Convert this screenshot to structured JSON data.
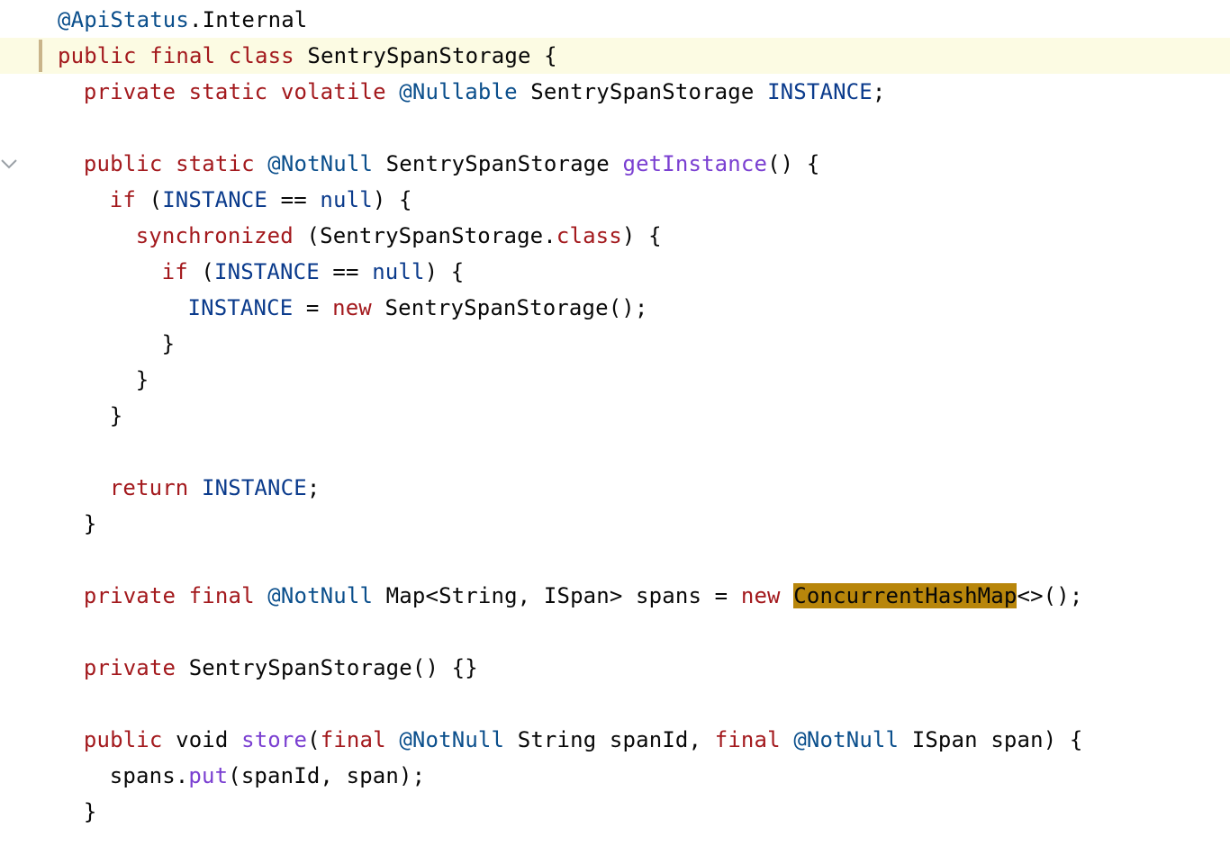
{
  "colors": {
    "plain": "#080808",
    "keyword": "#a3191d",
    "annotation": "#0b4f8c",
    "constant": "#0b3b8c",
    "method": "#7a3fd1",
    "fold_marker": "#9aa0a6"
  },
  "gutter": {
    "fold_markers": [
      {
        "line": 1,
        "icon": "chevron-down-icon"
      },
      {
        "line": 4,
        "icon": "chevron-down-icon"
      }
    ]
  },
  "code_lines": [
    {
      "indent": 4,
      "current": false,
      "segments": [
        {
          "text": "@ApiStatus",
          "kind": "annotation"
        },
        {
          "text": ".Internal",
          "kind": "plain"
        }
      ]
    },
    {
      "indent": 4,
      "current": true,
      "segments": [
        {
          "text": "public final class ",
          "kind": "keyword"
        },
        {
          "text": "SentrySpanStorage {",
          "kind": "plain"
        }
      ]
    },
    {
      "indent": 6,
      "current": false,
      "segments": [
        {
          "text": "private static volatile ",
          "kind": "keyword"
        },
        {
          "text": "@Nullable",
          "kind": "annotation"
        },
        {
          "text": " SentrySpanStorage ",
          "kind": "plain"
        },
        {
          "text": "INSTANCE",
          "kind": "constant"
        },
        {
          "text": ";",
          "kind": "plain"
        }
      ]
    },
    {
      "indent": 0,
      "current": false,
      "segments": []
    },
    {
      "indent": 6,
      "current": false,
      "segments": [
        {
          "text": "public static ",
          "kind": "keyword"
        },
        {
          "text": "@NotNull",
          "kind": "annotation"
        },
        {
          "text": " SentrySpanStorage ",
          "kind": "plain"
        },
        {
          "text": "getInstance",
          "kind": "method"
        },
        {
          "text": "() {",
          "kind": "plain"
        }
      ]
    },
    {
      "indent": 8,
      "current": false,
      "segments": [
        {
          "text": "if",
          "kind": "keyword"
        },
        {
          "text": " (",
          "kind": "plain"
        },
        {
          "text": "INSTANCE",
          "kind": "constant"
        },
        {
          "text": " == ",
          "kind": "plain"
        },
        {
          "text": "null",
          "kind": "constant"
        },
        {
          "text": ") {",
          "kind": "plain"
        }
      ]
    },
    {
      "indent": 10,
      "current": false,
      "segments": [
        {
          "text": "synchronized",
          "kind": "keyword"
        },
        {
          "text": " (SentrySpanStorage.",
          "kind": "plain"
        },
        {
          "text": "class",
          "kind": "keyword"
        },
        {
          "text": ") {",
          "kind": "plain"
        }
      ]
    },
    {
      "indent": 12,
      "current": false,
      "segments": [
        {
          "text": "if",
          "kind": "keyword"
        },
        {
          "text": " (",
          "kind": "plain"
        },
        {
          "text": "INSTANCE",
          "kind": "constant"
        },
        {
          "text": " == ",
          "kind": "plain"
        },
        {
          "text": "null",
          "kind": "constant"
        },
        {
          "text": ") {",
          "kind": "plain"
        }
      ]
    },
    {
      "indent": 14,
      "current": false,
      "segments": [
        {
          "text": "INSTANCE",
          "kind": "constant"
        },
        {
          "text": " = ",
          "kind": "plain"
        },
        {
          "text": "new",
          "kind": "keyword"
        },
        {
          "text": " SentrySpanStorage();",
          "kind": "plain"
        }
      ]
    },
    {
      "indent": 12,
      "current": false,
      "segments": [
        {
          "text": "}",
          "kind": "plain"
        }
      ]
    },
    {
      "indent": 10,
      "current": false,
      "segments": [
        {
          "text": "}",
          "kind": "plain"
        }
      ]
    },
    {
      "indent": 8,
      "current": false,
      "segments": [
        {
          "text": "}",
          "kind": "plain"
        }
      ]
    },
    {
      "indent": 0,
      "current": false,
      "segments": []
    },
    {
      "indent": 8,
      "current": false,
      "segments": [
        {
          "text": "return",
          "kind": "keyword"
        },
        {
          "text": " ",
          "kind": "plain"
        },
        {
          "text": "INSTANCE",
          "kind": "constant"
        },
        {
          "text": ";",
          "kind": "plain"
        }
      ]
    },
    {
      "indent": 6,
      "current": false,
      "segments": [
        {
          "text": "}",
          "kind": "plain"
        }
      ]
    },
    {
      "indent": 0,
      "current": false,
      "segments": []
    },
    {
      "indent": 6,
      "current": false,
      "segments": [
        {
          "text": "private final ",
          "kind": "keyword"
        },
        {
          "text": "@NotNull",
          "kind": "annotation"
        },
        {
          "text": " Map<String, ISpan> spans = ",
          "kind": "plain"
        },
        {
          "text": "new",
          "kind": "keyword"
        },
        {
          "text": " ",
          "kind": "plain"
        },
        {
          "text": "ConcurrentHashMap",
          "kind": "plain",
          "highlight": true
        },
        {
          "text": "<>();",
          "kind": "plain"
        }
      ]
    },
    {
      "indent": 0,
      "current": false,
      "segments": []
    },
    {
      "indent": 6,
      "current": false,
      "segments": [
        {
          "text": "private",
          "kind": "keyword"
        },
        {
          "text": " SentrySpanStorage() {}",
          "kind": "plain"
        }
      ]
    },
    {
      "indent": 0,
      "current": false,
      "segments": []
    },
    {
      "indent": 6,
      "current": false,
      "segments": [
        {
          "text": "public",
          "kind": "keyword"
        },
        {
          "text": " void ",
          "kind": "plain"
        },
        {
          "text": "store",
          "kind": "method"
        },
        {
          "text": "(",
          "kind": "plain"
        },
        {
          "text": "final",
          "kind": "keyword"
        },
        {
          "text": " ",
          "kind": "plain"
        },
        {
          "text": "@NotNull",
          "kind": "annotation"
        },
        {
          "text": " String spanId, ",
          "kind": "plain"
        },
        {
          "text": "final",
          "kind": "keyword"
        },
        {
          "text": " ",
          "kind": "plain"
        },
        {
          "text": "@NotNull",
          "kind": "annotation"
        },
        {
          "text": " ISpan span) {",
          "kind": "plain"
        }
      ]
    },
    {
      "indent": 8,
      "current": false,
      "segments": [
        {
          "text": "spans.",
          "kind": "plain"
        },
        {
          "text": "put",
          "kind": "method"
        },
        {
          "text": "(spanId, span);",
          "kind": "plain"
        }
      ]
    },
    {
      "indent": 6,
      "current": false,
      "segments": [
        {
          "text": "}",
          "kind": "plain"
        }
      ]
    }
  ]
}
